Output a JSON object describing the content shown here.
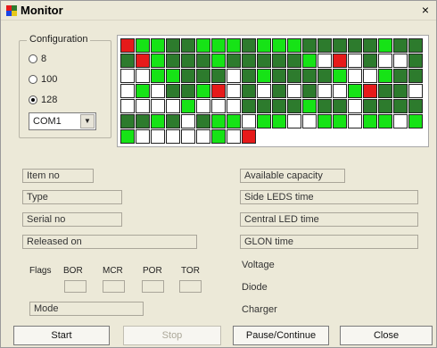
{
  "window": {
    "title": "Monitor",
    "close_glyph": "×"
  },
  "configuration": {
    "legend": "Configuration",
    "options": [
      {
        "label": "8",
        "selected": false
      },
      {
        "label": "100",
        "selected": false
      },
      {
        "label": "128",
        "selected": true
      }
    ],
    "port": "COM1"
  },
  "leds": {
    "colors": {
      "g": "#2d7b2d",
      "G": "#16e316",
      "w": "#ffffff",
      "r": "#e61a1a"
    },
    "rows": [
      [
        "r",
        "G",
        "G",
        "g",
        "g",
        "G",
        "G",
        "G",
        "g",
        "G",
        "G",
        "G",
        "g",
        "g",
        "g",
        "g",
        "g",
        "G",
        "g",
        "g"
      ],
      [
        "g",
        "r",
        "G",
        "g",
        "g",
        "g",
        "G",
        "g",
        "g",
        "g",
        "g",
        "g",
        "G",
        "w",
        "r",
        "w",
        "g",
        "w",
        "w",
        "g"
      ],
      [
        "w",
        "w",
        "G",
        "G",
        "g",
        "g",
        "g",
        "w",
        "g",
        "G",
        "g",
        "g",
        "g",
        "g",
        "G",
        "w",
        "w",
        "G",
        "g",
        "g"
      ],
      [
        "w",
        "G",
        "w",
        "g",
        "g",
        "G",
        "r",
        "w",
        "g",
        "w",
        "g",
        "w",
        "g",
        "w",
        "w",
        "G",
        "r",
        "g",
        "g",
        "w"
      ],
      [
        "w",
        "w",
        "w",
        "w",
        "G",
        "w",
        "w",
        "w",
        "g",
        "g",
        "g",
        "g",
        "G",
        "g",
        "g",
        "w",
        "g",
        "g",
        "g",
        "g"
      ],
      [
        "g",
        "g",
        "G",
        "g",
        "w",
        "g",
        "G",
        "G",
        "w",
        "G",
        "G",
        "w",
        "w",
        "G",
        "G",
        "w",
        "G",
        "G",
        "w",
        "G"
      ],
      [
        "G",
        "w",
        "w",
        "w",
        "w",
        "w",
        "G",
        "w",
        "r"
      ]
    ]
  },
  "info_left": {
    "item_no": "Item no",
    "type": "Type",
    "serial_no": "Serial no",
    "released_on": "Released on",
    "mode": "Mode"
  },
  "info_right": {
    "available_capacity": "Available capacity",
    "side_leds_time": "Side LEDS time",
    "central_led_time": "Central LED time",
    "glon_time": "GLON time",
    "voltage": "Voltage",
    "diode": "Diode",
    "charger": "Charger"
  },
  "flags": {
    "label": "Flags",
    "items": [
      "BOR",
      "MCR",
      "POR",
      "TOR"
    ]
  },
  "buttons": {
    "start": "Start",
    "stop": "Stop",
    "pause_continue": "Pause/Continue",
    "close": "Close"
  }
}
